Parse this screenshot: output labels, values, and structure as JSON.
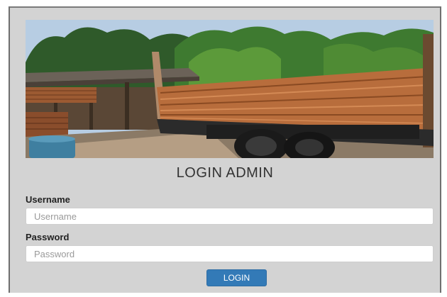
{
  "login": {
    "title": "LOGIN ADMIN",
    "username_label": "Username",
    "username_placeholder": "Username",
    "username_value": "",
    "password_label": "Password",
    "password_placeholder": "Password",
    "password_value": "",
    "submit_label": "LOGIN"
  },
  "colors": {
    "panel_background": "#d3d3d3",
    "button_primary": "#337ab7",
    "title_text": "#333333"
  }
}
